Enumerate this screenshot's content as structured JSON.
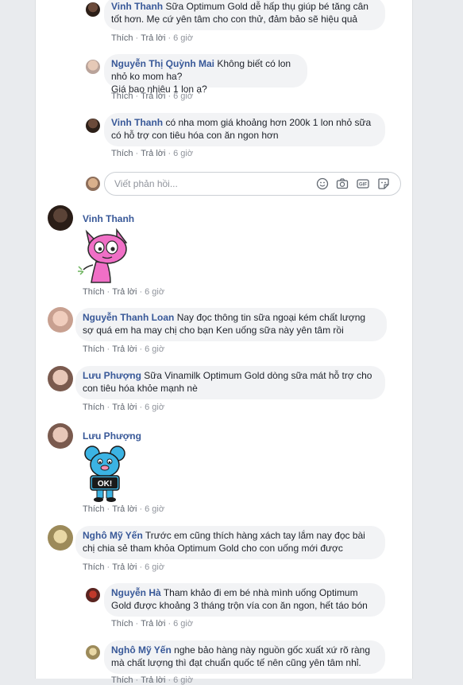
{
  "actions": {
    "like": "Thích",
    "reply": "Trả lời",
    "time": "6 giờ"
  },
  "reply_box": {
    "placeholder": "Viết phản hồi..."
  },
  "replies_top": [
    {
      "author": "Vinh Thanh",
      "text_l1": "Sữa Optimum Gold dễ hấp thụ giúp bé tăng cân",
      "text_l2": "tốt hơn. Mẹ cứ yên tâm cho con thử, đảm bảo sẽ hiệu quả"
    },
    {
      "author": "Nguyễn Thị Quỳnh Mai",
      "text_l1": "Không biết có lon nhỏ ko mom ha?",
      "text_l2": "Giá bao nhiêu 1 lon ạ?"
    },
    {
      "author": "Vinh Thanh",
      "text_l1": "có nha mom giá khoảng hơn 200k 1 lon nhỏ sữa",
      "text_l2": "có hỗ trợ con tiêu hóa con ăn ngon hơn"
    }
  ],
  "comments": [
    {
      "author": "Vinh Thanh",
      "sticker": "pink-cat-sticker"
    },
    {
      "author": "Nguyễn Thanh Loan",
      "text_l1": "Nay đọc thông tin sữa ngoại kém chất lượng",
      "text_l2": "sợ quá em ha may chị cho bạn Ken uống sữa này yên tâm rồi"
    },
    {
      "author": "Lưu Phượng",
      "text_l1": "Sữa Vinamilk Optimum Gold dòng sữa mát hỗ trợ cho",
      "text_l2": "con tiêu hóa khỏe mạnh nè"
    },
    {
      "author": "Lưu Phượng",
      "sticker": "ok-mouse-sticker",
      "sticker_text": "OK!"
    },
    {
      "author": "Nghô Mỹ Yến",
      "text_l1": "Trước em cũng thích hàng xách tay lắm nay đọc bài",
      "text_l2": "chị chia sẻ tham khỏa Optimum Gold cho con uống mới được"
    }
  ],
  "replies_bottom": [
    {
      "author": "Nguyễn Hà",
      "text_l1": "Tham khảo đi em bé nhà mình uống Optimum",
      "text_l2": "Gold được khoảng 3 tháng trộn vía con ăn ngon, hết táo bón"
    },
    {
      "author": "Nghô Mỹ Yến",
      "text_l1": "nghe bảo hàng này nguồn gốc xuất xứ rõ ràng",
      "text_l2": "mà chất lượng thì đạt chuẩn quốc tế nên cũng yên tâm nhỉ."
    }
  ],
  "colors": {
    "link": "#385898",
    "bubble": "#f2f3f5",
    "meta": "#90949c"
  }
}
